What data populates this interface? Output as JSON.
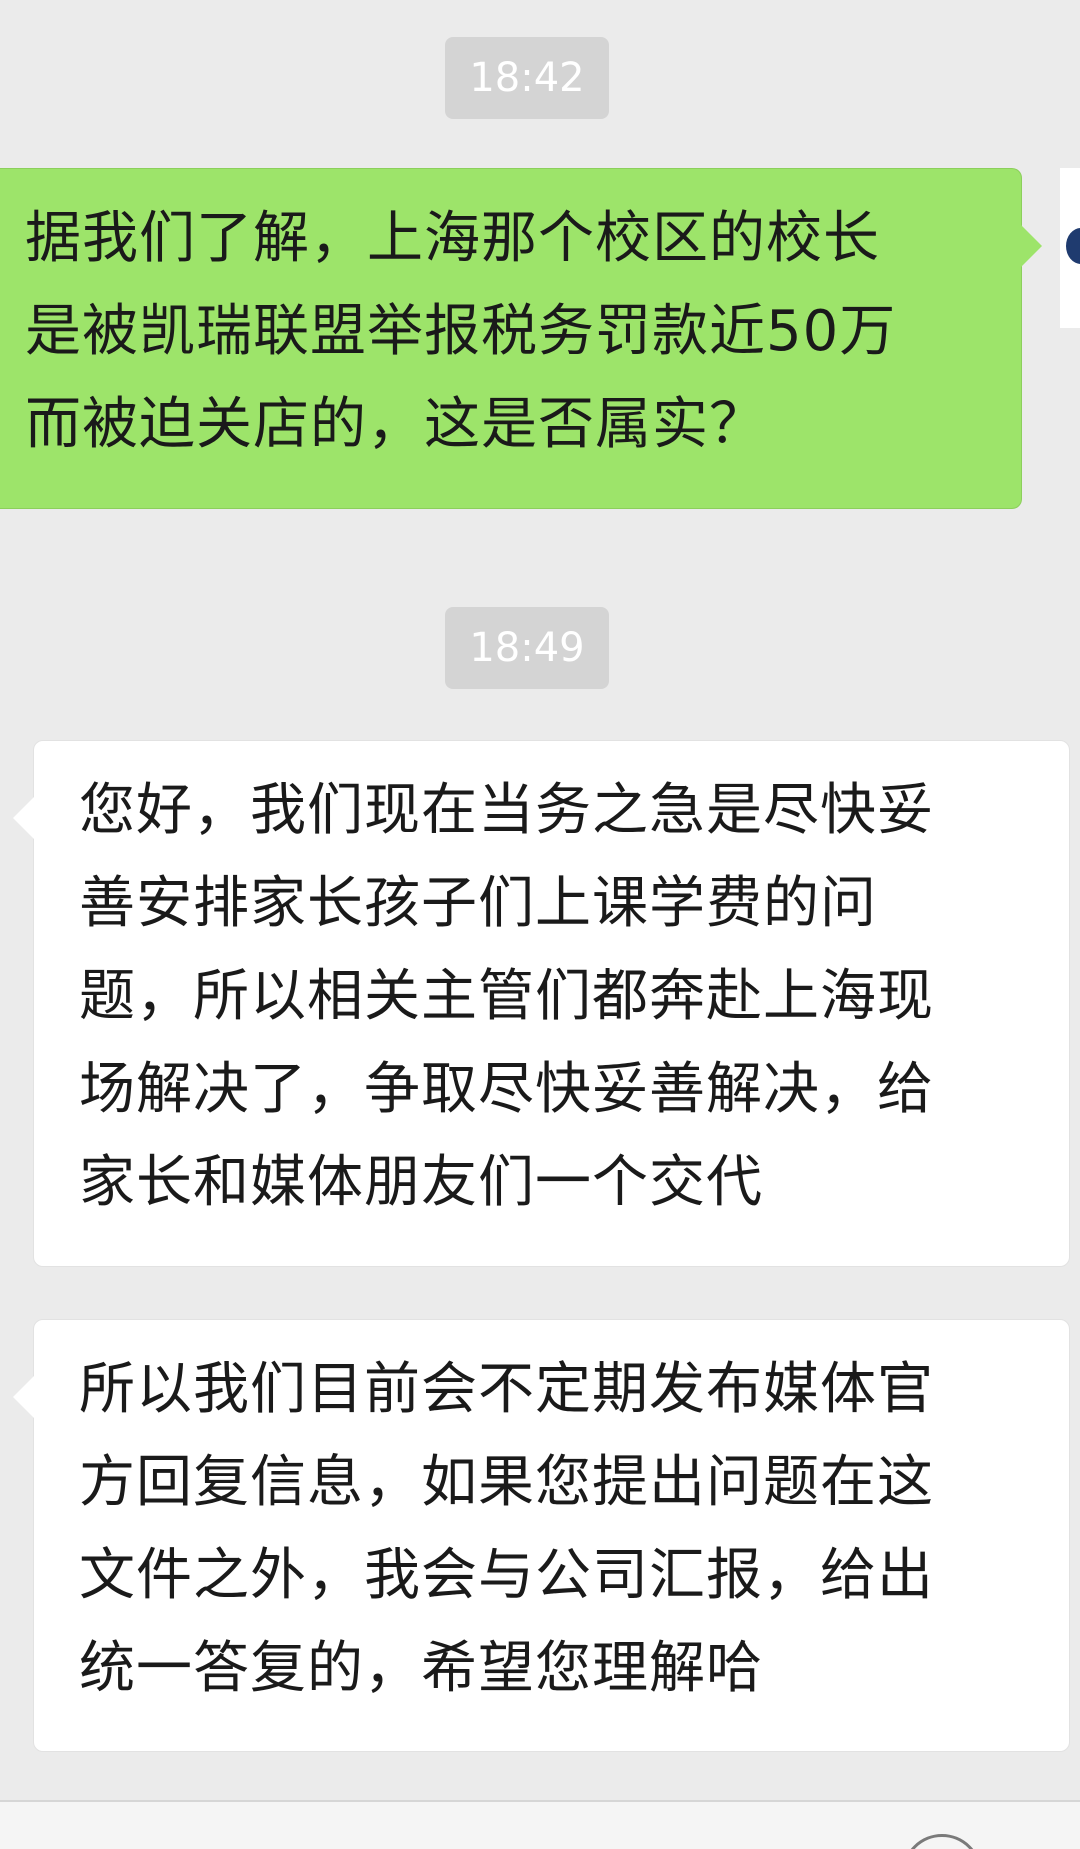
{
  "messages": [
    {
      "type": "timestamp",
      "text": "18:42"
    },
    {
      "type": "sent",
      "lines": [
        "据我们了解，上海那个校区的校长",
        "是被凯瑞联盟举报税务罚款近50万",
        "而被迫关店的，这是否属实？"
      ]
    },
    {
      "type": "timestamp",
      "text": "18:49"
    },
    {
      "type": "received",
      "lines": [
        "您好，我们现在当务之急是尽快妥",
        "善安排家长孩子们上课学费的问",
        "题，所以相关主管们都奔赴上海现",
        "场解决了，争取尽快妥善解决，给",
        "家长和媒体朋友们一个交代"
      ]
    },
    {
      "type": "received",
      "lines": [
        "所以我们目前会不定期发布媒体官",
        "方回复信息，如果您提出问题在这",
        "文件之外，我会与公司汇报，给出",
        "统一答复的，希望您理解哈"
      ]
    }
  ],
  "colors": {
    "background": "#ebebeb",
    "sent_bubble": "#9de46a",
    "received_bubble": "#ffffff",
    "timestamp_bg": "#d4d4d4",
    "timestamp_text": "#ffffff"
  },
  "icons": {
    "input_bar_right": "emoji-icon"
  }
}
